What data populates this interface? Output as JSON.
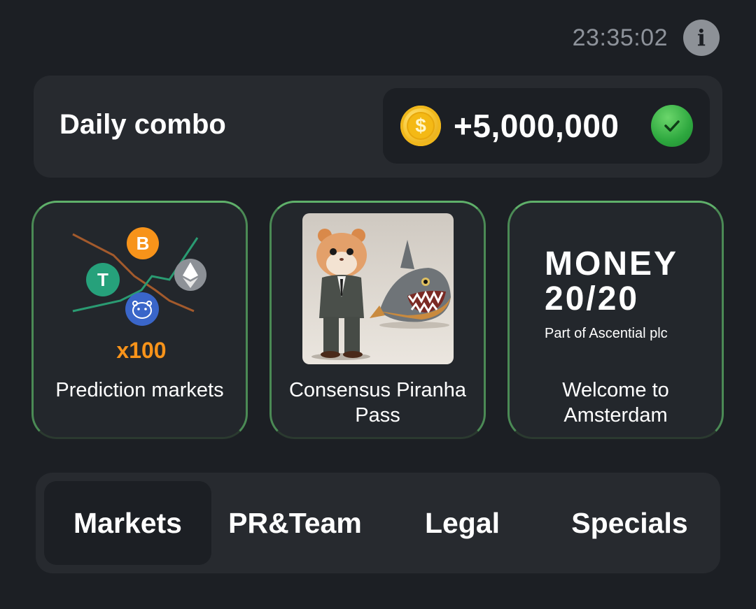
{
  "header": {
    "timer": "23:35:02",
    "info_icon": "info-icon"
  },
  "daily_combo": {
    "title": "Daily combo",
    "reward": "+5,000,000",
    "coin_icon": "coin-icon",
    "coin_symbol": "$",
    "status_icon": "check-icon"
  },
  "cards": [
    {
      "label": "Prediction markets",
      "badge": "x100",
      "bitcoin_symbol": "B",
      "tether_symbol": "T"
    },
    {
      "label": "Consensus Piranha Pass"
    },
    {
      "label": "Welcome to Amsterdam",
      "logo_line1": "MONEY",
      "logo_line2": "20/20",
      "logo_tagline": "Part of Ascential plc"
    }
  ],
  "tabs": [
    {
      "label": "Markets",
      "active": true
    },
    {
      "label": "PR&Team",
      "active": false
    },
    {
      "label": "Legal",
      "active": false
    },
    {
      "label": "Specials",
      "active": false
    }
  ],
  "colors": {
    "background": "#1c1f24",
    "panel": "#272a2f",
    "card_border": "#5fb06a",
    "badge_orange": "#f7931a"
  }
}
